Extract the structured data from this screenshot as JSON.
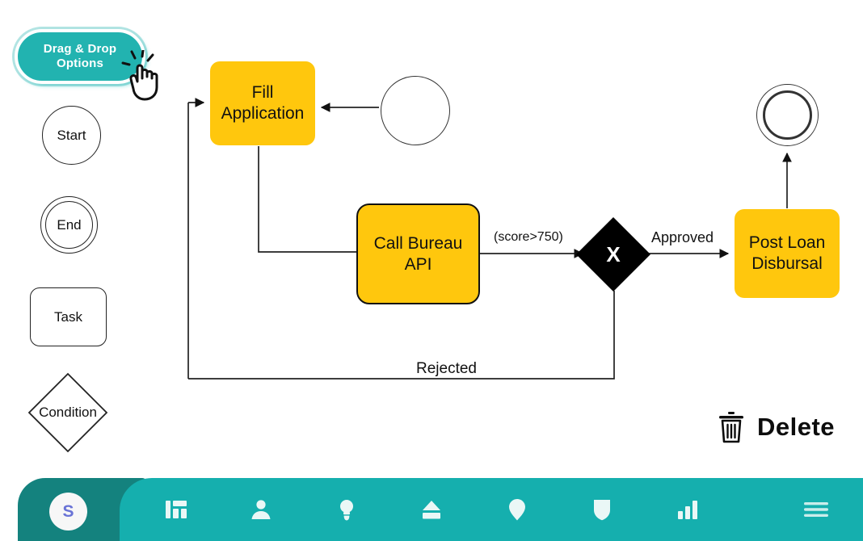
{
  "palette": {
    "drag_drop_button": {
      "label": "Drag & Drop\nOptions",
      "icon": "hand-pointer-icon",
      "bg_color": "#22b3b0",
      "text_color": "#ffffff"
    },
    "shapes": [
      {
        "name": "start",
        "label": "Start",
        "shape": "circle"
      },
      {
        "name": "end",
        "label": "End",
        "shape": "double-circle"
      },
      {
        "name": "task",
        "label": "Task",
        "shape": "rounded-rect"
      },
      {
        "name": "condition",
        "label": "Condition",
        "shape": "diamond"
      }
    ]
  },
  "canvas": {
    "nodes": [
      {
        "id": "start-circle",
        "label": "",
        "shape": "circle",
        "fill": "#ffffff"
      },
      {
        "id": "fill-application",
        "label": "Fill\nApplication",
        "shape": "rounded-rect",
        "fill": "#FFC70D"
      },
      {
        "id": "call-bureau-api",
        "label": "Call Bureau\nAPI",
        "shape": "rounded-rect",
        "fill": "#FFC70D",
        "border": "#111111"
      },
      {
        "id": "decision",
        "label": "X",
        "shape": "diamond",
        "fill": "#000000",
        "text_color": "#ffffff"
      },
      {
        "id": "post-loan-disbursal",
        "label": "Post Loan\nDisbursal",
        "shape": "rounded-rect",
        "fill": "#FFC70D"
      },
      {
        "id": "end-circle",
        "label": "",
        "shape": "double-circle",
        "fill": "#ffffff"
      }
    ],
    "edge_labels": {
      "score": "(score>750)",
      "approved": "Approved",
      "rejected": "Rejected"
    }
  },
  "delete": {
    "label": "Delete",
    "icon": "trash-icon"
  },
  "bottom_bar": {
    "avatar_initial": "S",
    "avatar_text_color": "#6973D6",
    "bar_color": "#15AFAE",
    "accent_color": "#14827E",
    "icons": [
      {
        "name": "dashboard-icon"
      },
      {
        "name": "user-icon"
      },
      {
        "name": "lightbulb-icon"
      },
      {
        "name": "upload-icon"
      },
      {
        "name": "location-pin-icon"
      },
      {
        "name": "shield-icon"
      },
      {
        "name": "bar-chart-icon"
      },
      {
        "name": "menu-icon"
      }
    ]
  }
}
